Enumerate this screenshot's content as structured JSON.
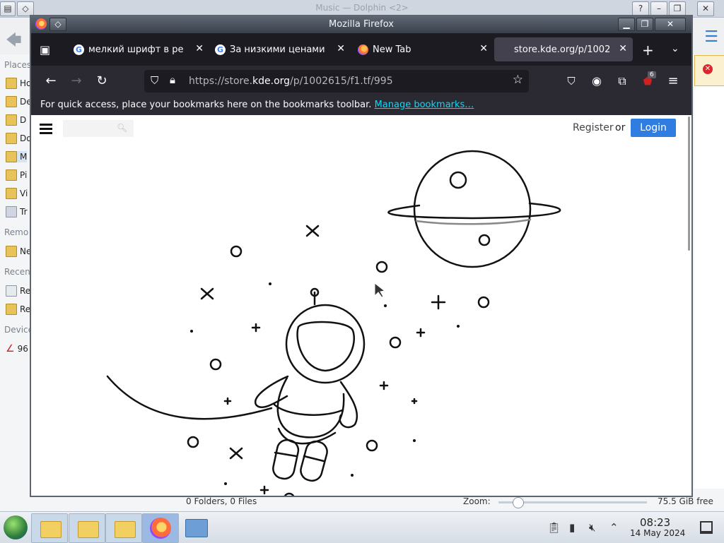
{
  "dolphin": {
    "title": "Music — Dolphin <2>",
    "sidebar": {
      "places_header": "Places",
      "remote_header": "Remo",
      "recent_header": "Recen",
      "devices_header": "Device",
      "items": [
        "Ho",
        "De",
        "D",
        "Do",
        "M",
        "Pi",
        "Vi",
        "Tr"
      ],
      "remote_items": [
        "Ne"
      ],
      "recent_items": [
        "Re",
        "Re"
      ],
      "device_items": [
        "96"
      ]
    },
    "status": {
      "counts": "0 Folders, 0 Files",
      "zoom_label": "Zoom:",
      "free_space": "75.5 GiB free"
    }
  },
  "firefox": {
    "window_title": "Mozilla Firefox",
    "tabs": [
      {
        "label": "мелкий шрифт в ре",
        "icon": "google-icon"
      },
      {
        "label": "За низкими ценами",
        "icon": "google-icon"
      },
      {
        "label": "New Tab",
        "icon": "firefox-icon"
      },
      {
        "label": "store.kde.org/p/1002",
        "icon": "none"
      }
    ],
    "url": {
      "prefix": "https://store.",
      "domain": "kde.org",
      "suffix": "/p/1002615/f1.tf/995"
    },
    "extensions_badge": "6",
    "bookmarks": {
      "message": "For quick access, place your bookmarks here on the bookmarks toolbar.",
      "link": "Manage bookmarks…"
    }
  },
  "site": {
    "search_placeholder": "",
    "register": "Register",
    "or": "or",
    "login": "Login"
  },
  "taskbar": {
    "clock_time": "08:23",
    "clock_date": "14 May 2024"
  }
}
